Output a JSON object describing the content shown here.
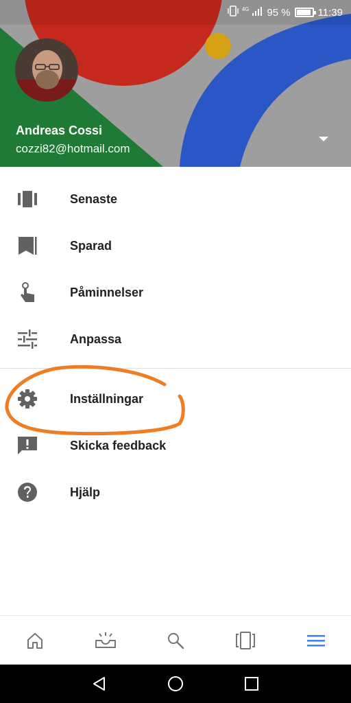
{
  "status_bar": {
    "network": "4G",
    "battery": "95 %",
    "battery_level": 0.95,
    "time": "11:39"
  },
  "account": {
    "name": "Andreas Cossi",
    "email": "cozzi82@hotmail.com"
  },
  "menu": {
    "items": [
      {
        "label": "Senaste",
        "icon": "recent-cards-icon"
      },
      {
        "label": "Sparad",
        "icon": "bookmark-icon"
      },
      {
        "label": "Påminnelser",
        "icon": "reminder-finger-icon"
      },
      {
        "label": "Anpassa",
        "icon": "tune-sliders-icon"
      },
      {
        "label": "Inställningar",
        "icon": "gear-icon"
      },
      {
        "label": "Skicka feedback",
        "icon": "feedback-icon"
      },
      {
        "label": "Hjälp",
        "icon": "help-icon"
      }
    ]
  },
  "bottom_nav": {
    "items": [
      "home-icon",
      "updates-tray-icon",
      "search-icon",
      "cards-icon",
      "menu-icon"
    ],
    "active": "menu-icon",
    "active_color": "#4285f4",
    "inactive_color": "#757575"
  },
  "colors": {
    "header_red": "#c5281c",
    "header_green": "#1e7a34",
    "header_blue": "#2a56c6",
    "header_yellow": "#f2b300",
    "header_gray": "#9e9e9e",
    "highlight": "#f07d22"
  }
}
